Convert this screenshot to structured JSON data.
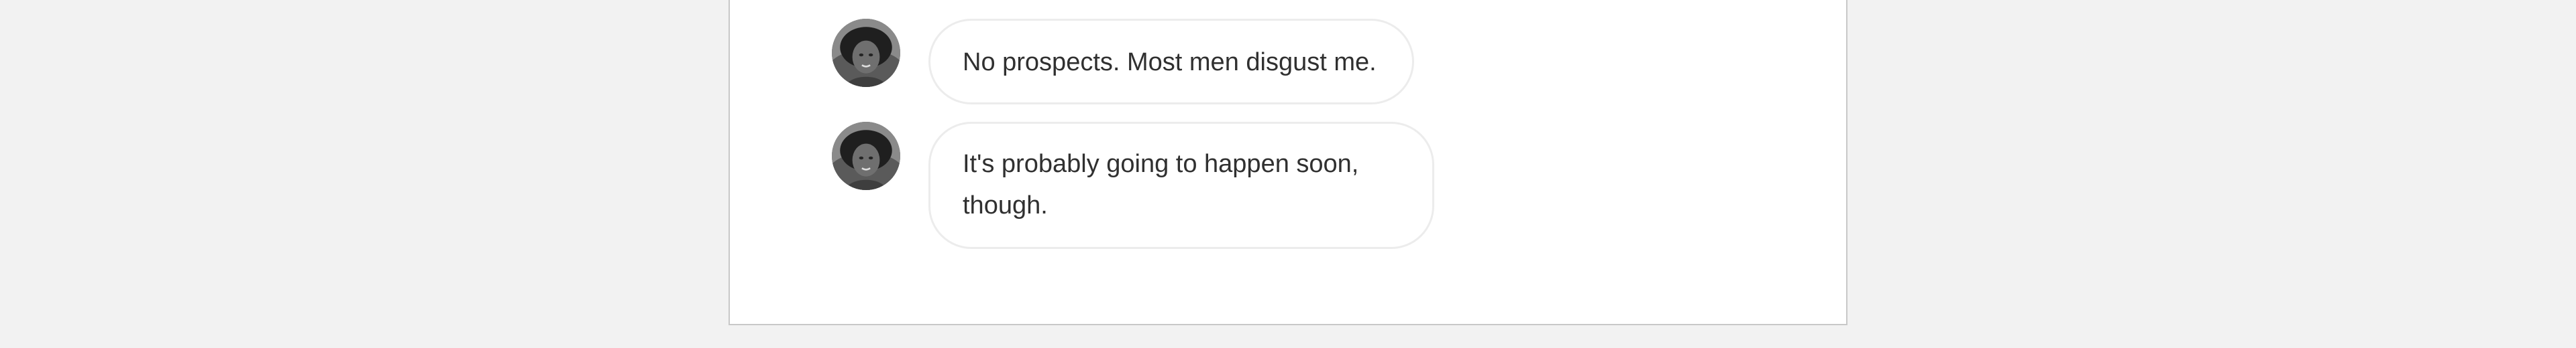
{
  "messages": [
    {
      "text": "No prospects. Most men disgust me."
    },
    {
      "text": "It's probably going to happen soon, though."
    }
  ],
  "colors": {
    "page_background": "#f2f2f2",
    "panel_background": "#ffffff",
    "bubble_border": "#ececec",
    "text": "#303030"
  },
  "icons": {
    "avatar": "user-avatar-photo"
  }
}
